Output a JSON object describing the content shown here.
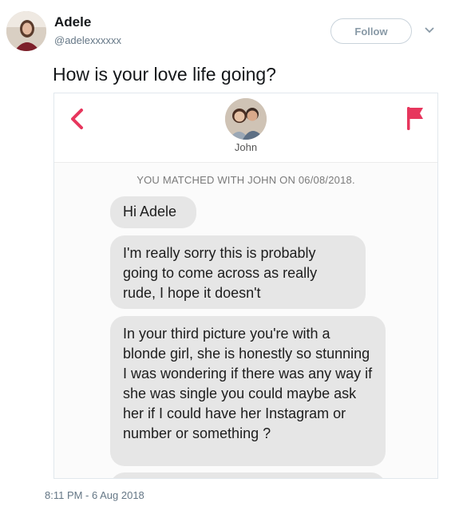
{
  "tweet": {
    "author_name": "Adele",
    "author_handle": "@adelexxxxxx",
    "follow_label": "Follow",
    "text": "How is your love life going?",
    "timestamp": "8:11 PM - 6 Aug 2018"
  },
  "chat": {
    "match_name": "John",
    "matched_note": "YOU MATCHED WITH JOHN ON 06/08/2018.",
    "messages": [
      "Hi Adele",
      "I'm really sorry this is probably going to come across as really rude, I hope it doesn't",
      "In your third picture you're with a blonde girl, she is honestly so stunning I was wondering if there was any way if she was single you could maybe ask her if I could have her Instagram or number or something ?"
    ]
  },
  "colors": {
    "accent": "#e7365d",
    "bubble": "#e6e6e6",
    "muted": "#657786"
  },
  "icons": {
    "back": "chevron-left-icon",
    "report": "flag-icon",
    "menu": "chevron-down-icon"
  }
}
